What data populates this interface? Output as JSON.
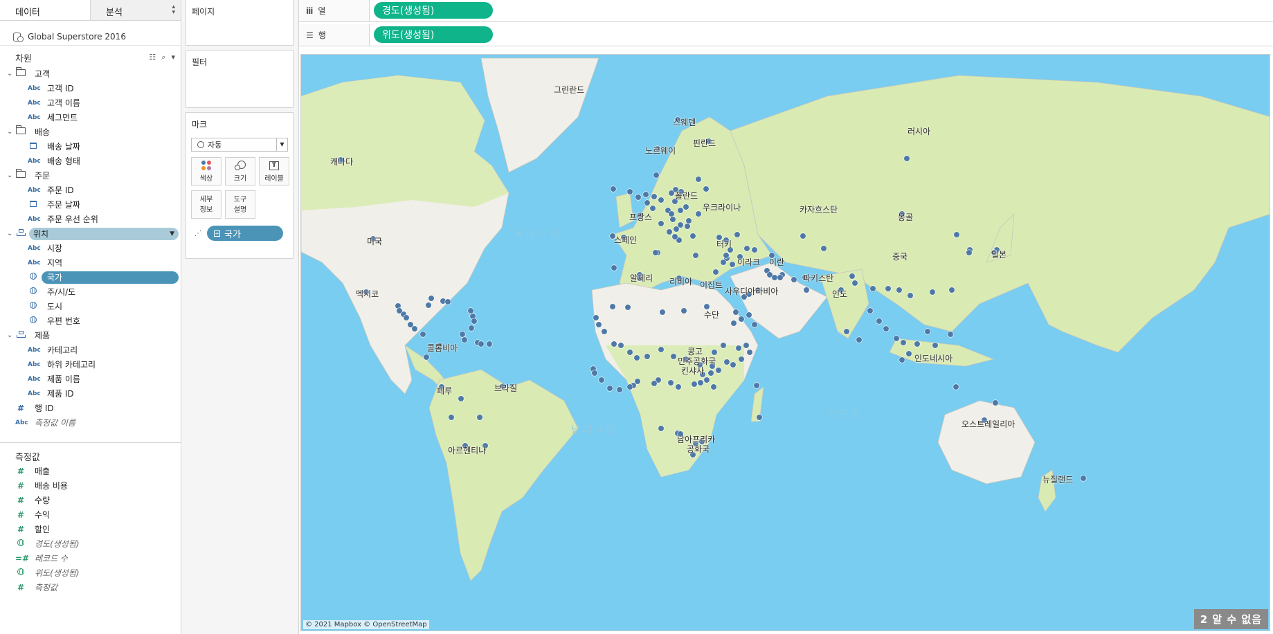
{
  "pane_tabs": {
    "data": "데이터",
    "analysis": "분석"
  },
  "datasource": "Global Superstore 2016",
  "dimensions_header": "차원",
  "dimensions": [
    {
      "type": "folder",
      "label": "고객"
    },
    {
      "type": "field",
      "icon": "Abc",
      "label": "고객 ID"
    },
    {
      "type": "field",
      "icon": "Abc",
      "label": "고객 이름"
    },
    {
      "type": "field",
      "icon": "Abc",
      "label": "세그먼트"
    },
    {
      "type": "folder",
      "label": "배송"
    },
    {
      "type": "field",
      "icon": "calendar",
      "label": "배송 날짜"
    },
    {
      "type": "field",
      "icon": "Abc",
      "label": "배송 형태"
    },
    {
      "type": "folder",
      "label": "주문"
    },
    {
      "type": "field",
      "icon": "Abc",
      "label": "주문 ID"
    },
    {
      "type": "field",
      "icon": "calendar",
      "label": "주문 날짜"
    },
    {
      "type": "field",
      "icon": "Abc",
      "label": "주문 우선 순위"
    },
    {
      "type": "hierarchy-selected",
      "label": "위치"
    },
    {
      "type": "field",
      "icon": "Abc",
      "label": "시장"
    },
    {
      "type": "field",
      "icon": "Abc",
      "label": "지역"
    },
    {
      "type": "field-selected",
      "icon": "globe",
      "label": "국가"
    },
    {
      "type": "field",
      "icon": "globe",
      "label": "주/시/도"
    },
    {
      "type": "field",
      "icon": "globe",
      "label": "도시"
    },
    {
      "type": "field",
      "icon": "globe",
      "label": "우편 번호"
    },
    {
      "type": "hierarchy",
      "label": "제품"
    },
    {
      "type": "field",
      "icon": "Abc",
      "label": "카테고리"
    },
    {
      "type": "field",
      "icon": "Abc",
      "label": "하위 카테고리"
    },
    {
      "type": "field",
      "icon": "Abc",
      "label": "제품 이름"
    },
    {
      "type": "field",
      "icon": "Abc",
      "label": "제품 ID"
    },
    {
      "type": "top",
      "icon": "#",
      "label": "행 ID"
    },
    {
      "type": "top-italic",
      "icon": "Abc",
      "label": "측정값 이름"
    }
  ],
  "measures_header": "측정값",
  "measures": [
    {
      "icon": "#",
      "label": "매출",
      "italic": false
    },
    {
      "icon": "#",
      "label": "배송 비용",
      "italic": false
    },
    {
      "icon": "#",
      "label": "수량",
      "italic": false
    },
    {
      "icon": "#",
      "label": "수익",
      "italic": false
    },
    {
      "icon": "#",
      "label": "할인",
      "italic": false
    },
    {
      "icon": "globe",
      "label": "경도(생성됨)",
      "italic": true
    },
    {
      "icon": "=#",
      "label": "레코드 수",
      "italic": true
    },
    {
      "icon": "globe",
      "label": "위도(생성됨)",
      "italic": true
    },
    {
      "icon": "#",
      "label": "측정값",
      "italic": true
    }
  ],
  "cards": {
    "pages": "페이지",
    "filters": "필터",
    "marks": "마크",
    "mark_type": "자동",
    "color": "색상",
    "size": "크기",
    "label": "레이블",
    "detail_1": "세부",
    "detail_2": "정보",
    "tooltip_1": "도구",
    "tooltip_2": "설명",
    "detail_pill": "국가"
  },
  "shelves": {
    "columns_label": "열",
    "columns_pill": "경도(생성됨)",
    "rows_label": "행",
    "rows_pill": "위도(생성됨)"
  },
  "map": {
    "labels": {
      "greenland": "그린란드",
      "canada": "캐나다",
      "usa": "미국",
      "mexico": "멕시코",
      "colombia": "콜롬비아",
      "peru": "페루",
      "brazil": "브라질",
      "argentina": "아르헨티나",
      "sweden": "스웨덴",
      "norway": "노르웨이",
      "finland": "핀란드",
      "russia": "러시아",
      "poland": "폴란드",
      "ukraine": "우크라이나",
      "france": "프랑스",
      "spain": "스페인",
      "kazakhstan": "카자흐스탄",
      "mongolia": "몽골",
      "china": "중국",
      "japan": "일본",
      "turkey": "터키",
      "iraq": "이라크",
      "iran": "이란",
      "pakistan": "파키스탄",
      "india": "인도",
      "algeria": "알제리",
      "libya": "리비아",
      "egypt": "이집트",
      "saudi": "사우디아라비아",
      "sudan": "수단",
      "drc_1": "콩고",
      "drc_2": "민주공화국",
      "drc_3": "킨샤사",
      "south_africa_1": "남아프리카",
      "south_africa_2": "공화국",
      "indonesia": "인도네시아",
      "australia": "오스트레일리아",
      "new_zealand": "뉴질랜드"
    },
    "oceans": {
      "north_atlantic": "북대서양",
      "south_atlantic": "남대서양",
      "indian": "인도양"
    },
    "attribution": "© 2021 Mapbox © OpenStreetMap",
    "unknown_badge": "2 알 수 없음",
    "colors": {
      "ocean": "#78cdf0",
      "land": "#f1efe9",
      "green_land": "#d9ebb3",
      "mark": "#4e79a7",
      "pill_green": "#10b48a",
      "pill_blue": "#4b94b7"
    }
  }
}
